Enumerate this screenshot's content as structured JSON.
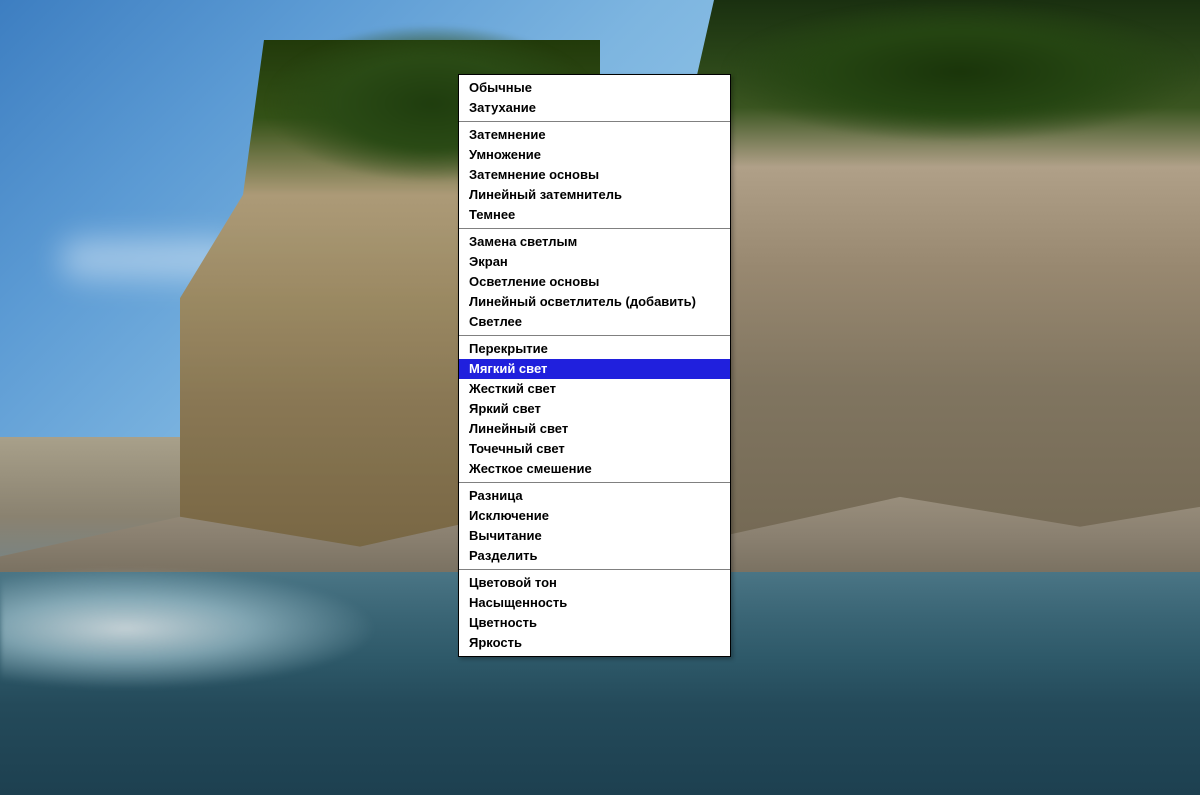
{
  "menu": {
    "selected_index": 13,
    "groups": [
      {
        "items": [
          {
            "label": "Обычные"
          },
          {
            "label": "Затухание"
          }
        ]
      },
      {
        "items": [
          {
            "label": "Затемнение"
          },
          {
            "label": "Умножение"
          },
          {
            "label": "Затемнение основы"
          },
          {
            "label": "Линейный затемнитель"
          },
          {
            "label": "Темнее"
          }
        ]
      },
      {
        "items": [
          {
            "label": "Замена светлым"
          },
          {
            "label": "Экран"
          },
          {
            "label": "Осветление основы"
          },
          {
            "label": "Линейный осветлитель (добавить)"
          },
          {
            "label": "Светлее"
          }
        ]
      },
      {
        "items": [
          {
            "label": "Перекрытие"
          },
          {
            "label": "Мягкий свет",
            "selected": true
          },
          {
            "label": "Жесткий свет"
          },
          {
            "label": "Яркий свет"
          },
          {
            "label": "Линейный свет"
          },
          {
            "label": "Точечный свет"
          },
          {
            "label": "Жесткое смешение"
          }
        ]
      },
      {
        "items": [
          {
            "label": "Разница"
          },
          {
            "label": "Исключение"
          },
          {
            "label": "Вычитание"
          },
          {
            "label": "Разделить"
          }
        ]
      },
      {
        "items": [
          {
            "label": "Цветовой тон"
          },
          {
            "label": "Насыщенность"
          },
          {
            "label": "Цветность"
          },
          {
            "label": "Яркость"
          }
        ]
      }
    ]
  }
}
